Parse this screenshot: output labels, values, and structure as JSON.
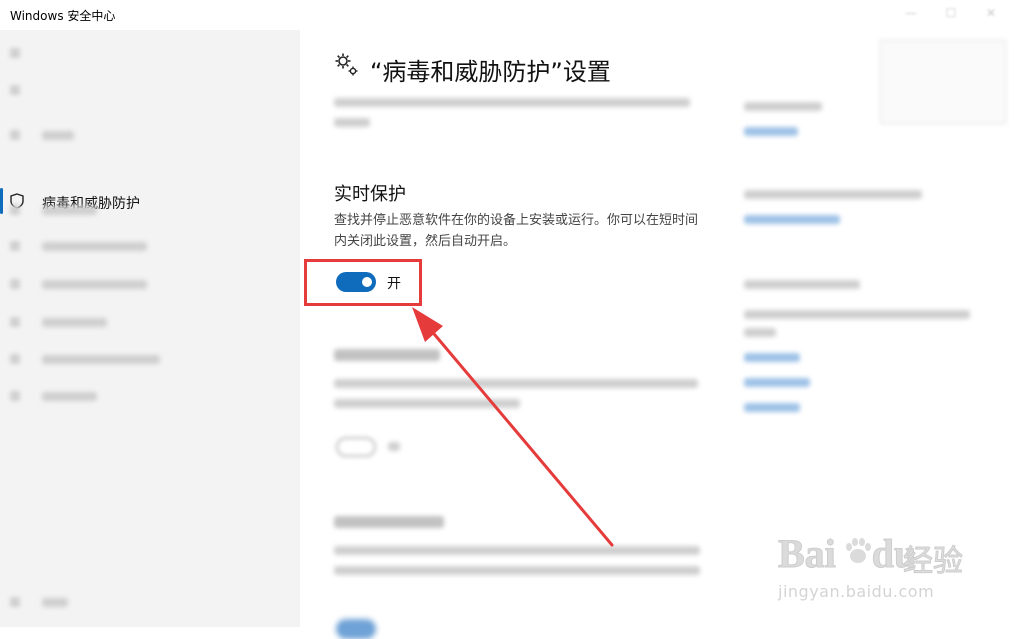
{
  "window": {
    "title": "Windows 安全中心"
  },
  "sidebar": {
    "active_item": {
      "label": "病毒和威胁防护",
      "icon": "shield-icon"
    }
  },
  "main": {
    "page_title": "“病毒和威胁防护”设置",
    "section": {
      "heading": "实时保护",
      "description": "查找并停止恶意软件在你的设备上安装或运行。你可以在短时间内关闭此设置，然后自动开启。",
      "toggle": {
        "state_label": "开",
        "is_on": true
      }
    }
  },
  "watermark": {
    "brand": "Bai",
    "brand_tail": "du",
    "cn": "经验",
    "url": "jingyan.baidu.com"
  },
  "colors": {
    "accent": "#0f6cbd",
    "highlight": "#e53b3b"
  }
}
